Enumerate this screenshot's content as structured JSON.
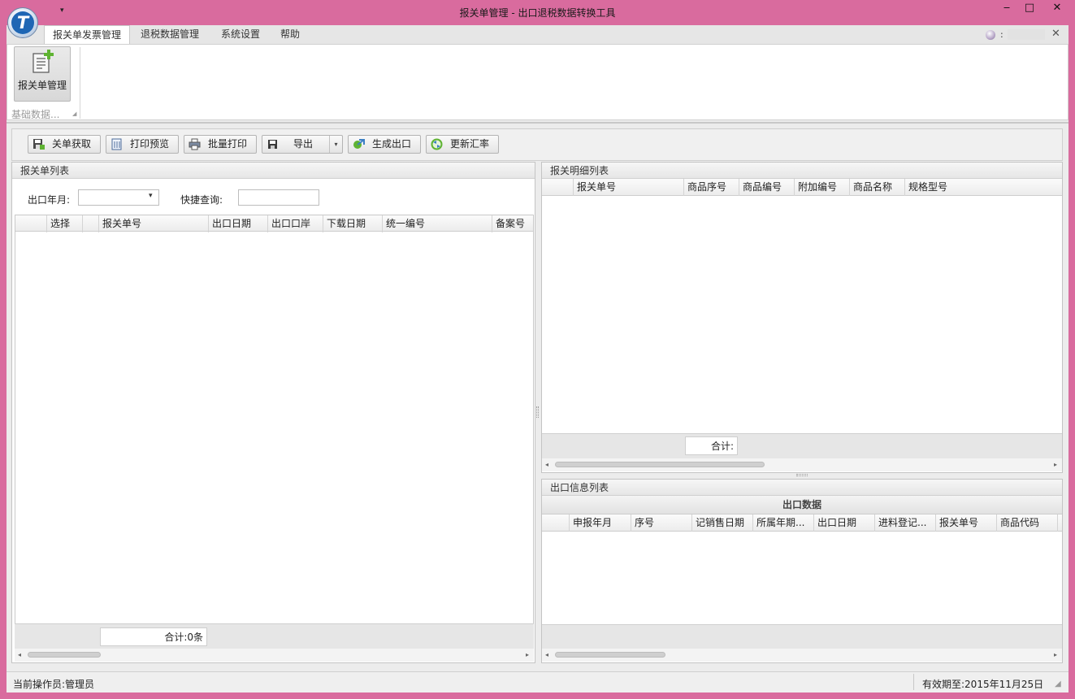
{
  "window": {
    "title": "报关单管理 - 出口退税数据转换工具",
    "logo_letter": "T",
    "quick_access_arrow": "▾",
    "minimize": "‒",
    "maximize": "□",
    "close": "✕"
  },
  "ribbon": {
    "tabs": [
      {
        "label": "报关单发票管理",
        "active": true
      },
      {
        "label": "退税数据管理",
        "active": false
      },
      {
        "label": "系统设置",
        "active": false
      },
      {
        "label": "帮助",
        "active": false
      }
    ],
    "user_colon": ":",
    "close_glyph": "✕",
    "big_button_label": "报关单管理",
    "group_label": "基础数据...",
    "group_launcher": "◢"
  },
  "toolbar": {
    "fetch": "关单获取",
    "preview": "打印预览",
    "batch_print": "批量打印",
    "export": "导出",
    "export_dropdown": "▾",
    "generate": "生成出口",
    "update_rate": "更新汇率"
  },
  "left_panel": {
    "title": "报关单列表",
    "month_label": "出口年月:",
    "month_arrow": "▾",
    "quick_label": "快捷查询:",
    "columns": [
      "",
      "选择",
      "",
      "报关单号",
      "出口日期",
      "出口口岸",
      "下载日期",
      "统一编号",
      "备案号"
    ],
    "total": "合计:0条"
  },
  "detail_panel": {
    "title": "报关明细列表",
    "columns": [
      "",
      "报关单号",
      "商品序号",
      "商品编号",
      "附加编号",
      "商品名称",
      "规格型号"
    ],
    "total": "合计:"
  },
  "export_panel": {
    "title": "出口信息列表",
    "band": "出口数据",
    "columns": [
      "",
      "申报年月",
      "序号",
      "记销售日期",
      "所属年期...",
      "出口日期",
      "进料登记...",
      "报关单号",
      "商品代码"
    ]
  },
  "statusbar": {
    "operator": "当前操作员:管理员",
    "expiry": "有效期至:2015年11月25日",
    "grip": "◢"
  },
  "scroll": {
    "left": "◂",
    "right": "▸"
  },
  "colors": {
    "window_frame": "#d96b9e",
    "panel_bg": "#ececec",
    "logo_blue": "#1e66b4"
  }
}
